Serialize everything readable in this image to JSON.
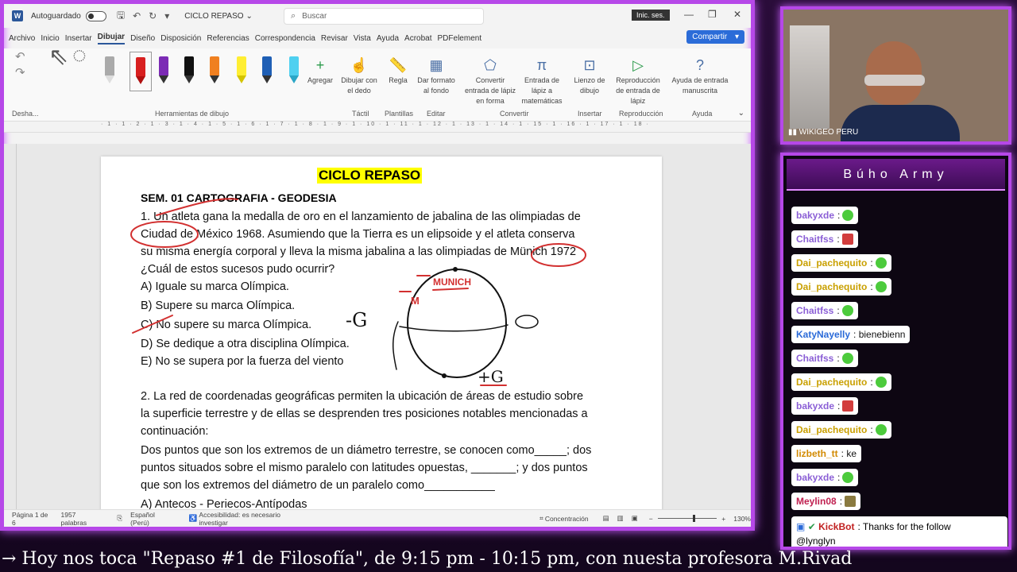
{
  "word": {
    "autosave_label": "Autoguardado",
    "doc_name": "CICLO REPASO",
    "search_placeholder": "Buscar",
    "signin": "Inic. ses.",
    "menu": [
      "Archivo",
      "Inicio",
      "Insertar",
      "Dibujar",
      "Diseño",
      "Disposición",
      "Referencias",
      "Correspondencia",
      "Revisar",
      "Vista",
      "Ayuda",
      "Acrobat",
      "PDFelement"
    ],
    "active_menu": "Dibujar",
    "share": "Compartir",
    "ribbon": {
      "undo_group": "Desha...",
      "draw_tools_group": "Herramientas de dibujo",
      "add": "Agregar",
      "draw_finger": "Dibujar con el dedo",
      "ruler": "Regla",
      "bg_format": "Dar formato al fondo",
      "ink_to_shape": "Convertir entrada de lápiz en forma",
      "ink_to_math": "Entrada de lápiz a matemáticas",
      "canvas": "Lienzo de dibujo",
      "replay": "Reproducción de entrada de lápiz",
      "help_ink": "Ayuda de entrada manuscrita",
      "touch_group": "Táctil",
      "templates_group": "Plantillas",
      "edit_group": "Editar",
      "convert_group": "Convertir",
      "insert_group": "Insertar",
      "replay_group": "Reproducción",
      "help_group": "Ayuda"
    },
    "ruler_text": "· 1 · 1 · 2 · 1 · 3 · 1 · 4 · 1 · 5 · 1 · 6 · 1 · 7 · 1 · 8 · 1 · 9 · 1 · 10 · 1 · 11 · 1 · 12 · 1 · 13 · 1 · 14 · 1 · 15 · 1 · 16 · 1 · 17 · 1 · 18 ·",
    "doc": {
      "title": "CICLO REPASO",
      "sem": "SEM. 01 CARTOGRAFIA -  GEODESIA",
      "lines": [
        "1. Un atleta gana la medalla de oro en el lanzamiento de jabalina de las olimpiadas de",
        "Ciudad de México 1968. Asumiendo que la Tierra es un elipsoide y el atleta conserva",
        "su misma energía corporal y lleva la misma jabalina a las olimpiadas de Münich 1972",
        "¿Cuál de estos sucesos pudo ocurrir?",
        "A) Iguale su marca Olímpica.",
        "B) Supere su marca Olímpica.",
        "C) No supere su marca Olímpica.",
        "D) Se dedique a otra disciplina Olímpica.",
        "E) No se supera por la fuerza del viento",
        "2. La red de coordenadas geográficas permiten la ubicación de áreas de estudio sobre",
        "la superficie terrestre y de ellas se desprenden tres posiciones notables mencionadas a",
        "continuación:",
        "Dos puntos que son los extremos de un diámetro terrestre, se conocen como_____; dos",
        "puntos situados sobre el mismo paralelo con latitudes opuestas, _______; y dos puntos",
        "que son los extremos del diámetro de un paralelo como___________",
        "A) Antecos - Periecos-Antípodas"
      ],
      "ink": {
        "munich": "MUNICH",
        "m": "M",
        "minus_g": "-G",
        "plus_g": "+G"
      }
    },
    "status": {
      "page": "Página 1 de 6",
      "words": "1957 palabras",
      "lang": "Español (Perú)",
      "access": "Accesibilidad: es necesario investigar",
      "focus": "Concentración",
      "zoom": "130%"
    }
  },
  "cam": {
    "label": "WIKIGEO PERU"
  },
  "chat": {
    "header": "Búho Army",
    "messages": [
      {
        "user": "bakyxde",
        "text": ":",
        "emote": "green"
      },
      {
        "user": "Chaitfss",
        "text": ":",
        "emote": "red"
      },
      {
        "user": "Dai_pachequito",
        "text": ":",
        "emote": "green"
      },
      {
        "user": "Dai_pachequito",
        "text": ":",
        "emote": "green"
      },
      {
        "user": "Chaitfss",
        "text": ":",
        "emote": "green"
      },
      {
        "user": "KatyNayelly",
        "text": ": bienebienn",
        "emote": ""
      },
      {
        "user": "Chaitfss",
        "text": ":",
        "emote": "green"
      },
      {
        "user": "Dai_pachequito",
        "text": ":",
        "emote": "green"
      },
      {
        "user": "bakyxde",
        "text": ":",
        "emote": "red"
      },
      {
        "user": "Dai_pachequito",
        "text": ":",
        "emote": "green"
      },
      {
        "user": "lizbeth_tt",
        "text": ": ke",
        "emote": ""
      },
      {
        "user": "bakyxde",
        "text": ":",
        "emote": "green"
      },
      {
        "user": "Meylin08",
        "text": ":",
        "emote": "red"
      }
    ],
    "kickbot_user": "KickBot",
    "kickbot_text": ": Thanks for the follow",
    "kickbot_handle": "@lynglyn"
  },
  "ticker": "→  Hoy nos toca \"Repaso #1 de Filosofía\", de 9:15 pm - 10:15 pm, con nuesta profesora M.Rivad"
}
